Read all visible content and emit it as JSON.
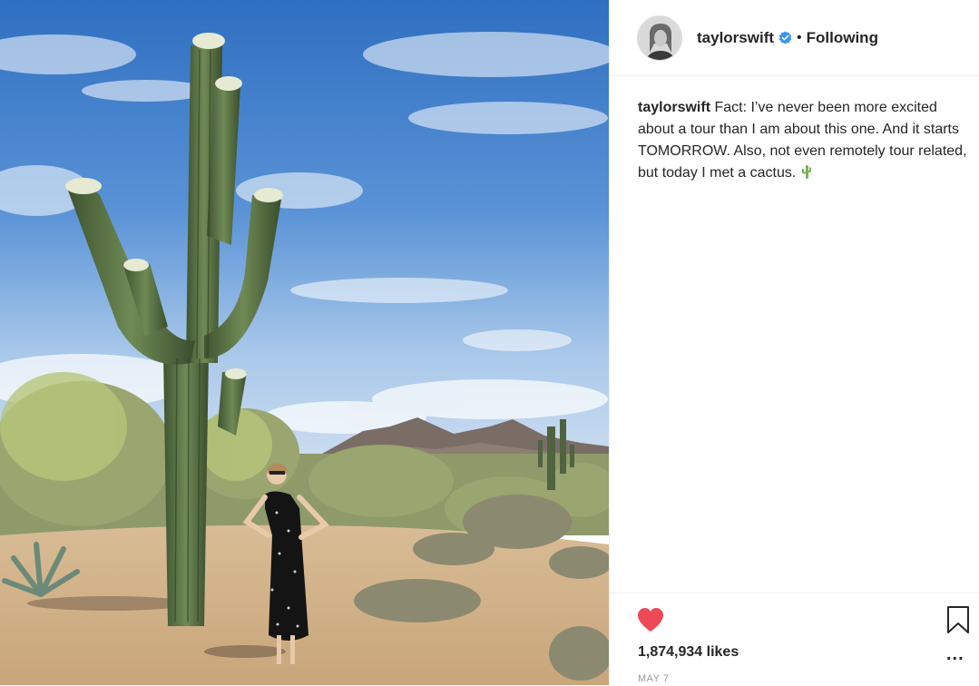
{
  "header": {
    "username": "taylorswift",
    "separator": "•",
    "follow_status": "Following"
  },
  "caption": {
    "username": "taylorswift",
    "text": "Fact: I’ve never been more excited about a tour than I am about this one. And it starts TOMORROW. Also, not even remotely tour related, but today I met a cactus."
  },
  "actions": {
    "likes": "1,874,934 likes",
    "more": "...",
    "date": "MAY 7"
  },
  "icons": {
    "verified": "verified-badge-icon",
    "heart": "heart-icon",
    "bookmark": "bookmark-icon",
    "cactus_emoji": "cactus-emoji-icon"
  },
  "colors": {
    "heart": "#ed4956",
    "verified": "#3897f0",
    "cactus": "#78b159",
    "date": "#999999"
  }
}
